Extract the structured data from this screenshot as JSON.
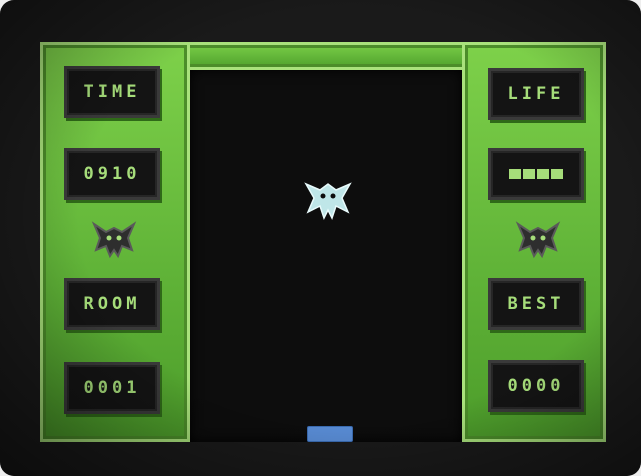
{
  "hud": {
    "time_label": "TIME",
    "time_value": "0910",
    "room_label": "ROOM",
    "room_value": "0001",
    "life_label": "LIFE",
    "life_segments": 4,
    "best_label": "BEST",
    "best_value": "0000"
  },
  "colors": {
    "frame": "#6cc23c",
    "hud_text": "#a6dd7a",
    "panel_bg": "#141414",
    "playfield": "#0d0d0d",
    "paddle": "#5a8ed8",
    "enemy": "#bfe6e8",
    "mascot": "#3a3a3a"
  },
  "sprites": {
    "enemy": "horned-creature-sprite",
    "left_mascot": "horned-creature-icon",
    "right_mascot": "horned-creature-icon",
    "paddle": "paddle"
  }
}
